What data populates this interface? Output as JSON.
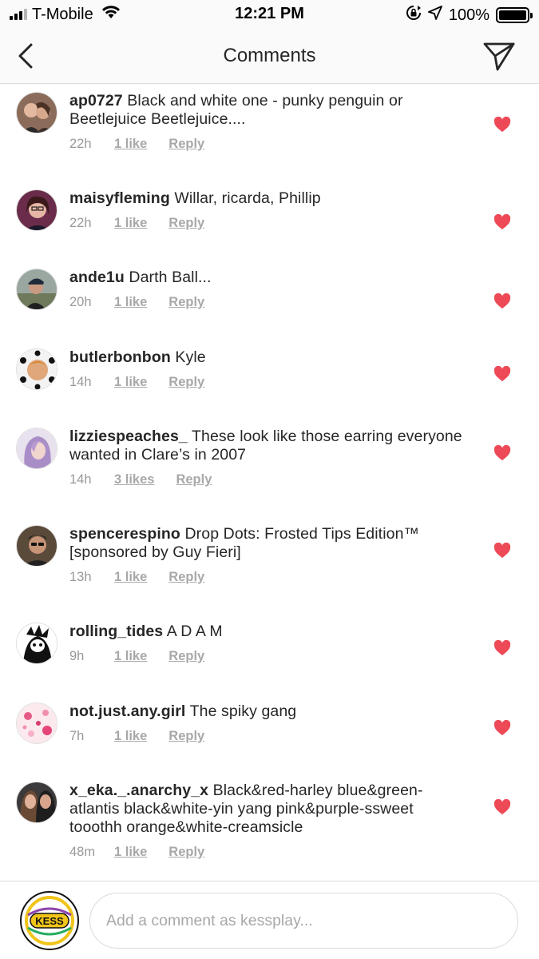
{
  "status_bar": {
    "carrier": "T-Mobile",
    "time": "12:21 PM",
    "battery": "100%"
  },
  "nav": {
    "title": "Comments"
  },
  "colors": {
    "heart": "#ed4956",
    "meta": "#999999",
    "text": "#262626"
  },
  "comments": [
    {
      "username": "ap0727",
      "text": "Black and white one - punky penguin or Beetlejuice Beetlejuice....",
      "time": "22h",
      "likes": "1 like",
      "reply": "Reply"
    },
    {
      "username": "maisyfleming",
      "text": "Willar, ricarda, Phillip",
      "time": "22h",
      "likes": "1 like",
      "reply": "Reply"
    },
    {
      "username": "ande1u",
      "text": "Darth Ball...",
      "time": "20h",
      "likes": "1 like",
      "reply": "Reply"
    },
    {
      "username": "butlerbonbon",
      "text": "Kyle",
      "time": "14h",
      "likes": "1 like",
      "reply": "Reply"
    },
    {
      "username": "lizziespeaches_",
      "text": "These look like those earring everyone wanted in Clare’s in 2007",
      "time": "14h",
      "likes": "3 likes",
      "reply": "Reply"
    },
    {
      "username": "spencerespino",
      "text": "Drop Dots: Frosted Tips Edition™ [sponsored by Guy Fieri]",
      "time": "13h",
      "likes": "1 like",
      "reply": "Reply"
    },
    {
      "username": "rolling_tides",
      "text": "A D A M",
      "time": "9h",
      "likes": "1 like",
      "reply": "Reply"
    },
    {
      "username": "not.just.any.girl",
      "text": "The spiky gang",
      "time": "7h",
      "likes": "1 like",
      "reply": "Reply"
    },
    {
      "username": "x_eka._.anarchy_x",
      "text": "Black&red-harley blue&green-atlantis black&white-yin yang pink&purple-ssweet tooothh orange&white-creamsicle",
      "time": "48m",
      "likes": "1 like",
      "reply": "Reply"
    }
  ],
  "composer": {
    "placeholder": "Add a comment as kessplay...",
    "avatar_text": "KESS"
  }
}
